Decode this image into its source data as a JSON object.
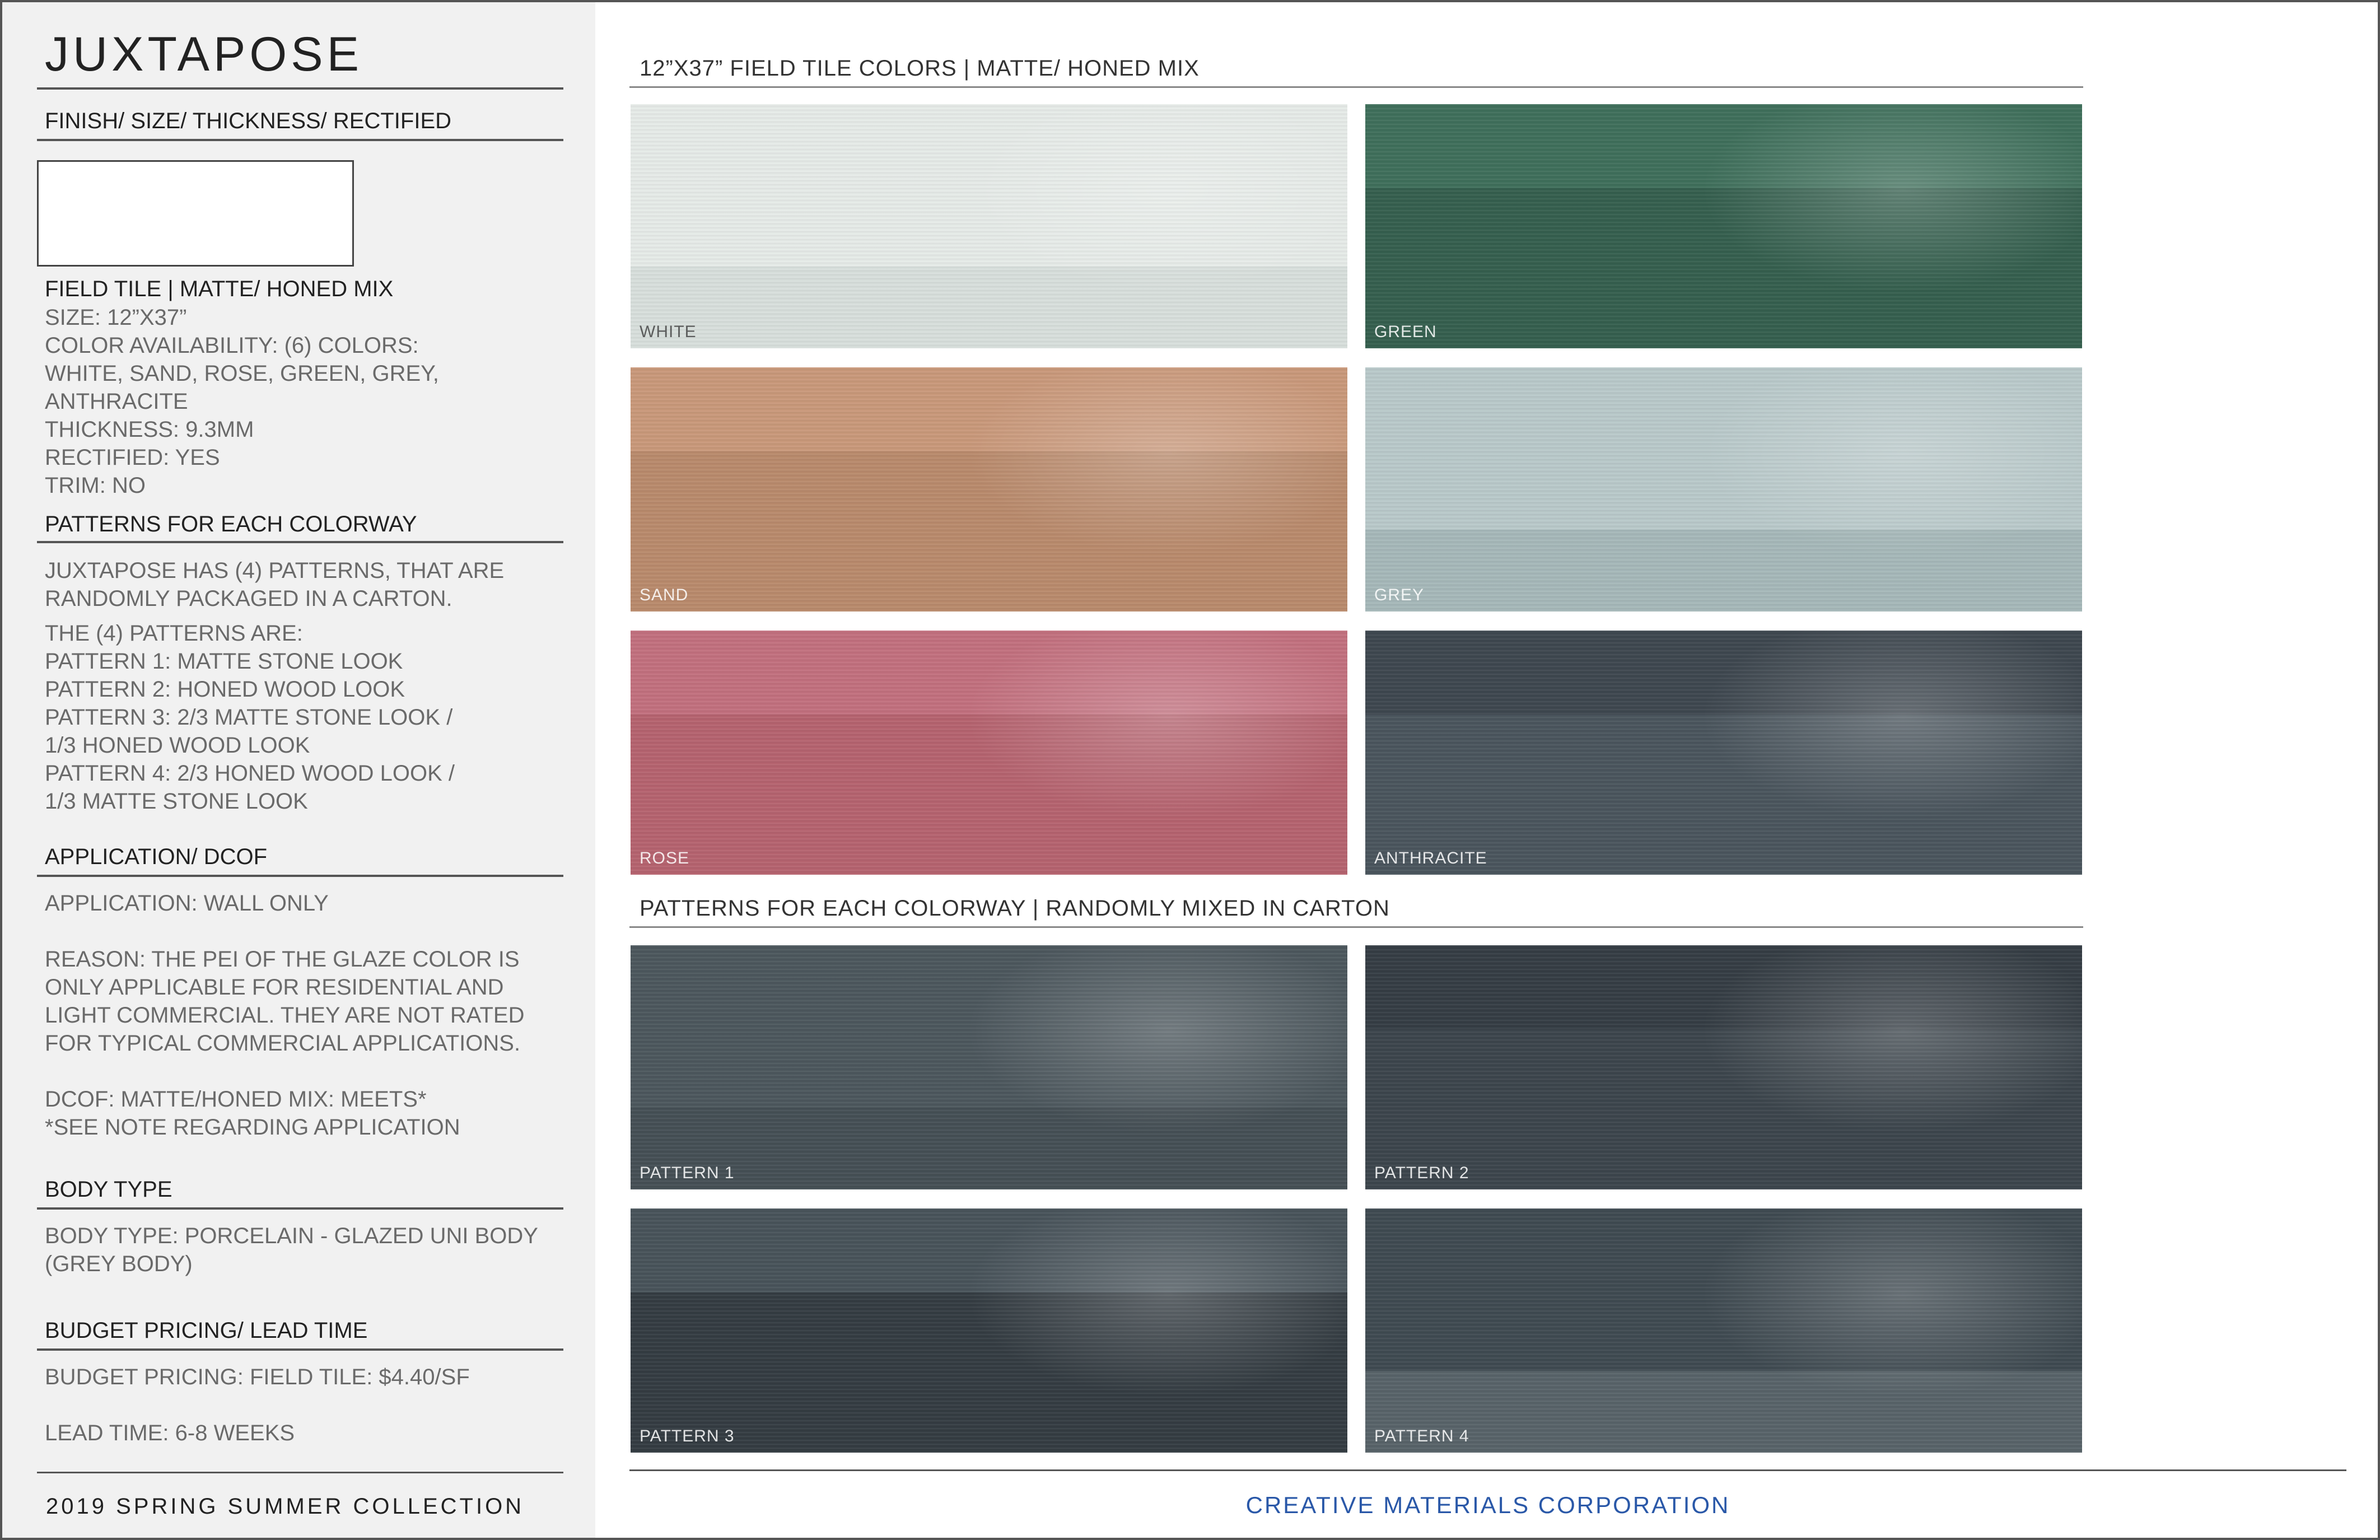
{
  "sidebar": {
    "title": "JUXTAPOSE",
    "finish_heading": "FINISH/ SIZE/ THICKNESS/ RECTIFIED",
    "field_tile_title": "FIELD TILE | MATTE/ HONED MIX",
    "field_tile_details": "SIZE: 12”X37”\nCOLOR AVAILABILITY: (6) COLORS:\nWHITE, SAND, ROSE, GREEN, GREY, ANTHRACITE\nTHICKNESS: 9.3MM\nRECTIFIED: YES\nTRIM: NO",
    "patterns_heading": "PATTERNS FOR EACH COLORWAY",
    "patterns_intro": "JUXTAPOSE HAS (4) PATTERNS, THAT ARE\nRANDOMLY PACKAGED IN A CARTON.",
    "patterns_list": "THE (4) PATTERNS ARE:\nPATTERN 1: MATTE STONE LOOK\nPATTERN 2: HONED WOOD LOOK\nPATTERN 3: 2/3 MATTE STONE LOOK /\n                1/3 HONED WOOD LOOK\nPATTERN 4: 2/3 HONED WOOD LOOK /\n                1/3 MATTE STONE LOOK",
    "application_heading": "APPLICATION/ DCOF",
    "application_text": "APPLICATION: WALL ONLY\n\nREASON: THE PEI OF THE GLAZE COLOR IS\nONLY APPLICABLE FOR RESIDENTIAL AND\nLIGHT COMMERCIAL. THEY ARE NOT RATED\nFOR TYPICAL COMMERCIAL APPLICATIONS.\n\nDCOF: MATTE/HONED MIX: MEETS*\n*SEE NOTE REGARDING APPLICATION",
    "body_type_heading": "BODY TYPE",
    "body_type_text": "BODY TYPE: PORCELAIN - GLAZED UNI BODY\n                 (GREY BODY)",
    "pricing_heading": "BUDGET PRICING/ LEAD TIME",
    "pricing_text": "BUDGET PRICING: FIELD TILE: $4.40/SF\n\nLEAD TIME: 6-8 WEEKS",
    "footer": "2019 SPRING SUMMER COLLECTION"
  },
  "main": {
    "colors_heading": "12”X37” FIELD TILE COLORS | MATTE/ HONED MIX",
    "colors": [
      {
        "label": "WHITE",
        "base": "#e6ebe8",
        "dark": "#d8dfdc",
        "light": true
      },
      {
        "label": "GREEN",
        "base": "#3f6f5b",
        "dark": "#355f4e",
        "light": false
      },
      {
        "label": "SAND",
        "base": "#c9987a",
        "dark": "#b98a6c",
        "light": false
      },
      {
        "label": "GREY",
        "base": "#b9c9ca",
        "dark": "#a6b8b9",
        "light": false
      },
      {
        "label": "ROSE",
        "base": "#c2707e",
        "dark": "#b5636f",
        "light": false
      },
      {
        "label": "ANTHRACITE",
        "base": "#3e474f",
        "dark": "#4a555d",
        "light": false
      }
    ],
    "patterns_heading": "PATTERNS FOR EACH COLORWAY | RANDOMLY MIXED IN CARTON",
    "patterns": [
      {
        "label": "PATTERN 1",
        "base": "#4c575d",
        "dark": "#454f55",
        "light": false
      },
      {
        "label": "PATTERN 2",
        "base": "#353d44",
        "dark": "#3c454c",
        "light": false
      },
      {
        "label": "PATTERN 3",
        "base": "#48535a",
        "dark": "#343c42",
        "light": false
      },
      {
        "label": "PATTERN 4",
        "base": "#3f4a51",
        "dark": "#586369",
        "light": false
      }
    ],
    "company": "CREATIVE MATERIALS CORPORATION"
  }
}
